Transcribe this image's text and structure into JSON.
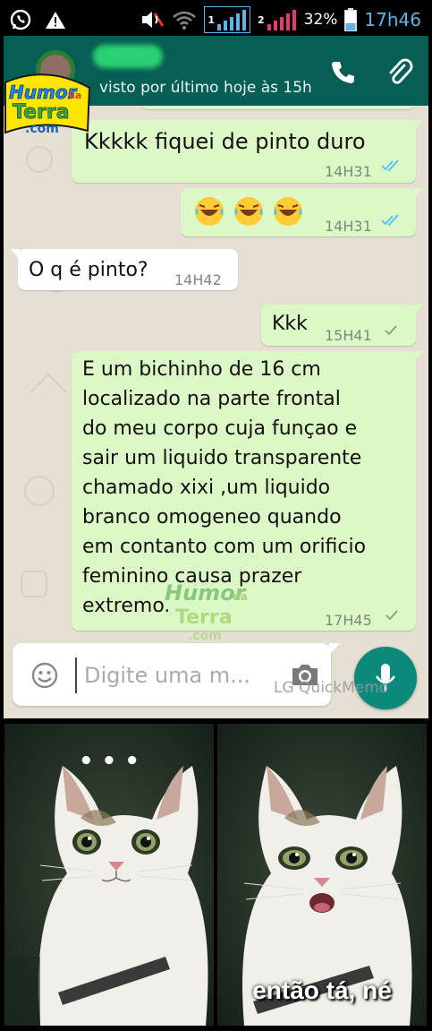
{
  "status_bar": {
    "battery_percent": "32%",
    "time": "17h46",
    "sim1_label": "1",
    "sim2_label": "2",
    "icons": [
      "whatsapp-icon",
      "warning-icon",
      "mute-icon",
      "wifi-icon",
      "signal-icon",
      "battery-icon"
    ]
  },
  "header": {
    "last_seen": "visto por último hoje às 15h",
    "logo_text": [
      "Humor",
      "da",
      "Terra",
      ".com"
    ],
    "icons": [
      "phone-icon",
      "attach-icon"
    ],
    "colors": {
      "bar": "#075e54"
    }
  },
  "messages": [
    {
      "type": "out",
      "text": "Kkkkk fiquei de pinto duro",
      "time": "14H31",
      "status": "read"
    },
    {
      "type": "out",
      "text": "😂😂😂",
      "time": "14H31",
      "status": "read"
    },
    {
      "type": "in",
      "text": "O q é pinto?",
      "time": "14H42"
    },
    {
      "type": "out",
      "text": "Kkk",
      "time": "15H41",
      "status": "sent"
    },
    {
      "type": "out",
      "lines": [
        "E um bichinho de 16 cm",
        "localizado na parte frontal",
        "do meu corpo cuja funçao e",
        "sair um liquido transparente",
        "chamado xixi ,um liquido",
        "branco omogeneo quando",
        "em contanto com um orificio",
        "feminino causa prazer",
        "extremo."
      ],
      "time": "17H45",
      "status": "sent"
    }
  ],
  "composer": {
    "placeholder": "Digite uma m...",
    "icons": [
      "emoji-icon",
      "camera-icon",
      "mic-icon"
    ]
  },
  "watermark": {
    "quickmemo": "LG QuickMemo"
  },
  "meme": {
    "left_dots": "• • •",
    "caption": "então tá, né"
  },
  "colors": {
    "outgoing_bubble": "#dcf8c6",
    "incoming_bubble": "#ffffff",
    "chat_bg": "#e6dfd4",
    "read_tick": "#4fc3f7",
    "accent": "#0b8a7c"
  }
}
